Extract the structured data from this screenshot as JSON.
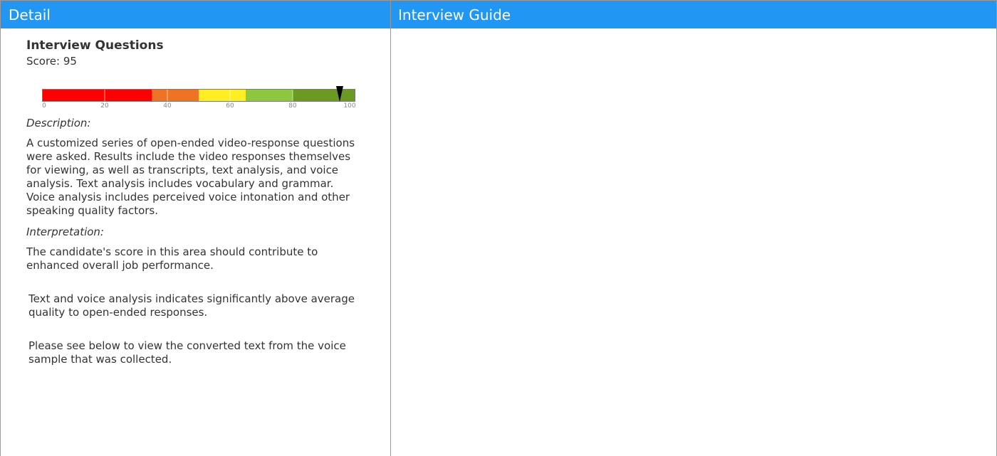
{
  "columns": {
    "detail": {
      "title": "Detail"
    },
    "guide": {
      "title": "Interview Guide"
    }
  },
  "section": {
    "title": "Interview Questions",
    "score_text": "Score: 95",
    "score": 95
  },
  "gauge": {
    "ticks": [
      "0",
      "20",
      "40",
      "60",
      "80",
      "100"
    ],
    "segments": [
      {
        "from": 0,
        "to": 35,
        "color": "#ff0000"
      },
      {
        "from": 35,
        "to": 50,
        "color": "#f07325"
      },
      {
        "from": 50,
        "to": 65,
        "color": "#ffee22"
      },
      {
        "from": 65,
        "to": 80,
        "color": "#8dc63f"
      },
      {
        "from": 80,
        "to": 100,
        "color": "#6a9a22"
      }
    ],
    "marker_value": 95
  },
  "description": {
    "label": "Description:",
    "text": "A customized series of open-ended video-response questions were asked. Results include the video responses themselves for viewing, as well as  transcripts, text analysis, and voice analysis. Text analysis includes vocabulary and grammar. Voice analysis includes perceived voice intonation and other speaking quality factors."
  },
  "interpretation": {
    "label": "Interpretation:",
    "text": "The candidate's score in this area should contribute to enhanced overall job performance.",
    "analysis": "Text and voice analysis indicates significantly above average quality to open-ended responses.",
    "note": "Please see below to view the converted text from the voice sample that was collected."
  }
}
